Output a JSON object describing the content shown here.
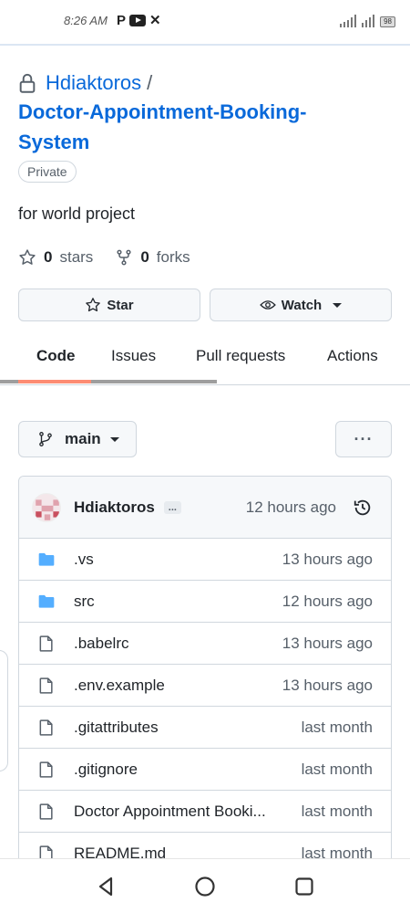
{
  "status_bar": {
    "time": "8:26 AM",
    "battery": "98"
  },
  "repo": {
    "owner": "Hdiaktoros",
    "separator": "/",
    "name": "Doctor-Appointment-Booking-System",
    "visibility": "Private",
    "description": "for world project",
    "stars_count": "0",
    "stars_label": "stars",
    "forks_count": "0",
    "forks_label": "forks"
  },
  "actions": {
    "star_label": "Star",
    "watch_label": "Watch"
  },
  "tabs": [
    {
      "label": "Code"
    },
    {
      "label": "Issues"
    },
    {
      "label": "Pull requests"
    },
    {
      "label": "Actions"
    }
  ],
  "branch": {
    "name": "main",
    "more_label": "···"
  },
  "latest_commit": {
    "author": "Hdiaktoros",
    "ellipsis": "...",
    "time": "12 hours ago"
  },
  "files": [
    {
      "name": ".vs",
      "type": "folder",
      "time": "13 hours ago"
    },
    {
      "name": "src",
      "type": "folder",
      "time": "12 hours ago"
    },
    {
      "name": ".babelrc",
      "type": "file",
      "time": "13 hours ago"
    },
    {
      "name": ".env.example",
      "type": "file",
      "time": "13 hours ago"
    },
    {
      "name": ".gitattributes",
      "type": "file",
      "time": "last month"
    },
    {
      "name": ".gitignore",
      "type": "file",
      "time": "last month"
    },
    {
      "name": "Doctor Appointment Booki...",
      "type": "file",
      "time": "last month"
    },
    {
      "name": "README.md",
      "type": "file",
      "time": "last month"
    }
  ],
  "colors": {
    "link": "#0969da",
    "active_tab": "#fd8c73",
    "folder": "#54aeff"
  }
}
